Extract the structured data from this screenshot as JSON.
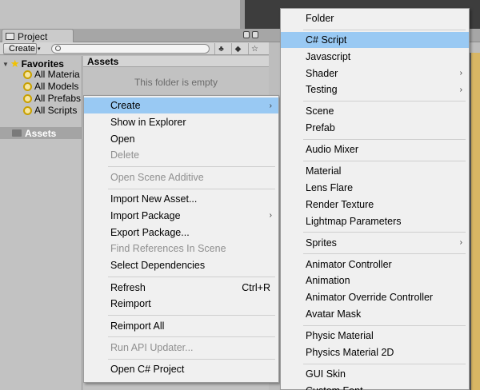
{
  "window": {
    "project_tab": "Project",
    "create_button": "Create",
    "create_arrow": "▾",
    "search_placeholder": ""
  },
  "tree": {
    "favorites_label": "Favorites",
    "favorites": [
      "All Materia",
      "All Models",
      "All Prefabs",
      "All Scripts"
    ],
    "assets_label": "Assets"
  },
  "content": {
    "header": "Assets",
    "empty_message": "This folder is empty"
  },
  "context_menu": [
    {
      "label": "Create",
      "submenu": true,
      "highlighted": true
    },
    {
      "label": "Show in Explorer"
    },
    {
      "label": "Open"
    },
    {
      "label": "Delete",
      "disabled": true
    },
    {
      "separator": true
    },
    {
      "label": "Open Scene Additive",
      "disabled": true
    },
    {
      "separator": true
    },
    {
      "label": "Import New Asset..."
    },
    {
      "label": "Import Package",
      "submenu": true
    },
    {
      "label": "Export Package..."
    },
    {
      "label": "Find References In Scene",
      "disabled": true
    },
    {
      "label": "Select Dependencies"
    },
    {
      "separator": true
    },
    {
      "label": "Refresh",
      "shortcut": "Ctrl+R"
    },
    {
      "label": "Reimport"
    },
    {
      "separator": true
    },
    {
      "label": "Reimport All"
    },
    {
      "separator": true
    },
    {
      "label": "Run API Updater...",
      "disabled": true
    },
    {
      "separator": true
    },
    {
      "label": "Open C# Project"
    }
  ],
  "create_submenu": [
    {
      "label": "Folder"
    },
    {
      "separator": true
    },
    {
      "label": "C# Script",
      "highlighted": true
    },
    {
      "label": "Javascript"
    },
    {
      "label": "Shader",
      "submenu": true
    },
    {
      "label": "Testing",
      "submenu": true
    },
    {
      "separator": true
    },
    {
      "label": "Scene"
    },
    {
      "label": "Prefab"
    },
    {
      "separator": true
    },
    {
      "label": "Audio Mixer"
    },
    {
      "separator": true
    },
    {
      "label": "Material"
    },
    {
      "label": "Lens Flare"
    },
    {
      "label": "Render Texture"
    },
    {
      "label": "Lightmap Parameters"
    },
    {
      "separator": true
    },
    {
      "label": "Sprites",
      "submenu": true
    },
    {
      "separator": true
    },
    {
      "label": "Animator Controller"
    },
    {
      "label": "Animation"
    },
    {
      "label": "Animator Override Controller"
    },
    {
      "label": "Avatar Mask"
    },
    {
      "separator": true
    },
    {
      "label": "Physic Material"
    },
    {
      "label": "Physics Material 2D"
    },
    {
      "separator": true
    },
    {
      "label": "GUI Skin"
    },
    {
      "label": "Custom Font"
    }
  ],
  "colors": {
    "highlight": "#99c9f3",
    "menu_bg": "#f0f0f0",
    "panel_bg": "#c2c2c2",
    "disabled_text": "#8f8f8f"
  },
  "icons": {
    "submenu_arrow": "›",
    "favorites_star": "★"
  }
}
